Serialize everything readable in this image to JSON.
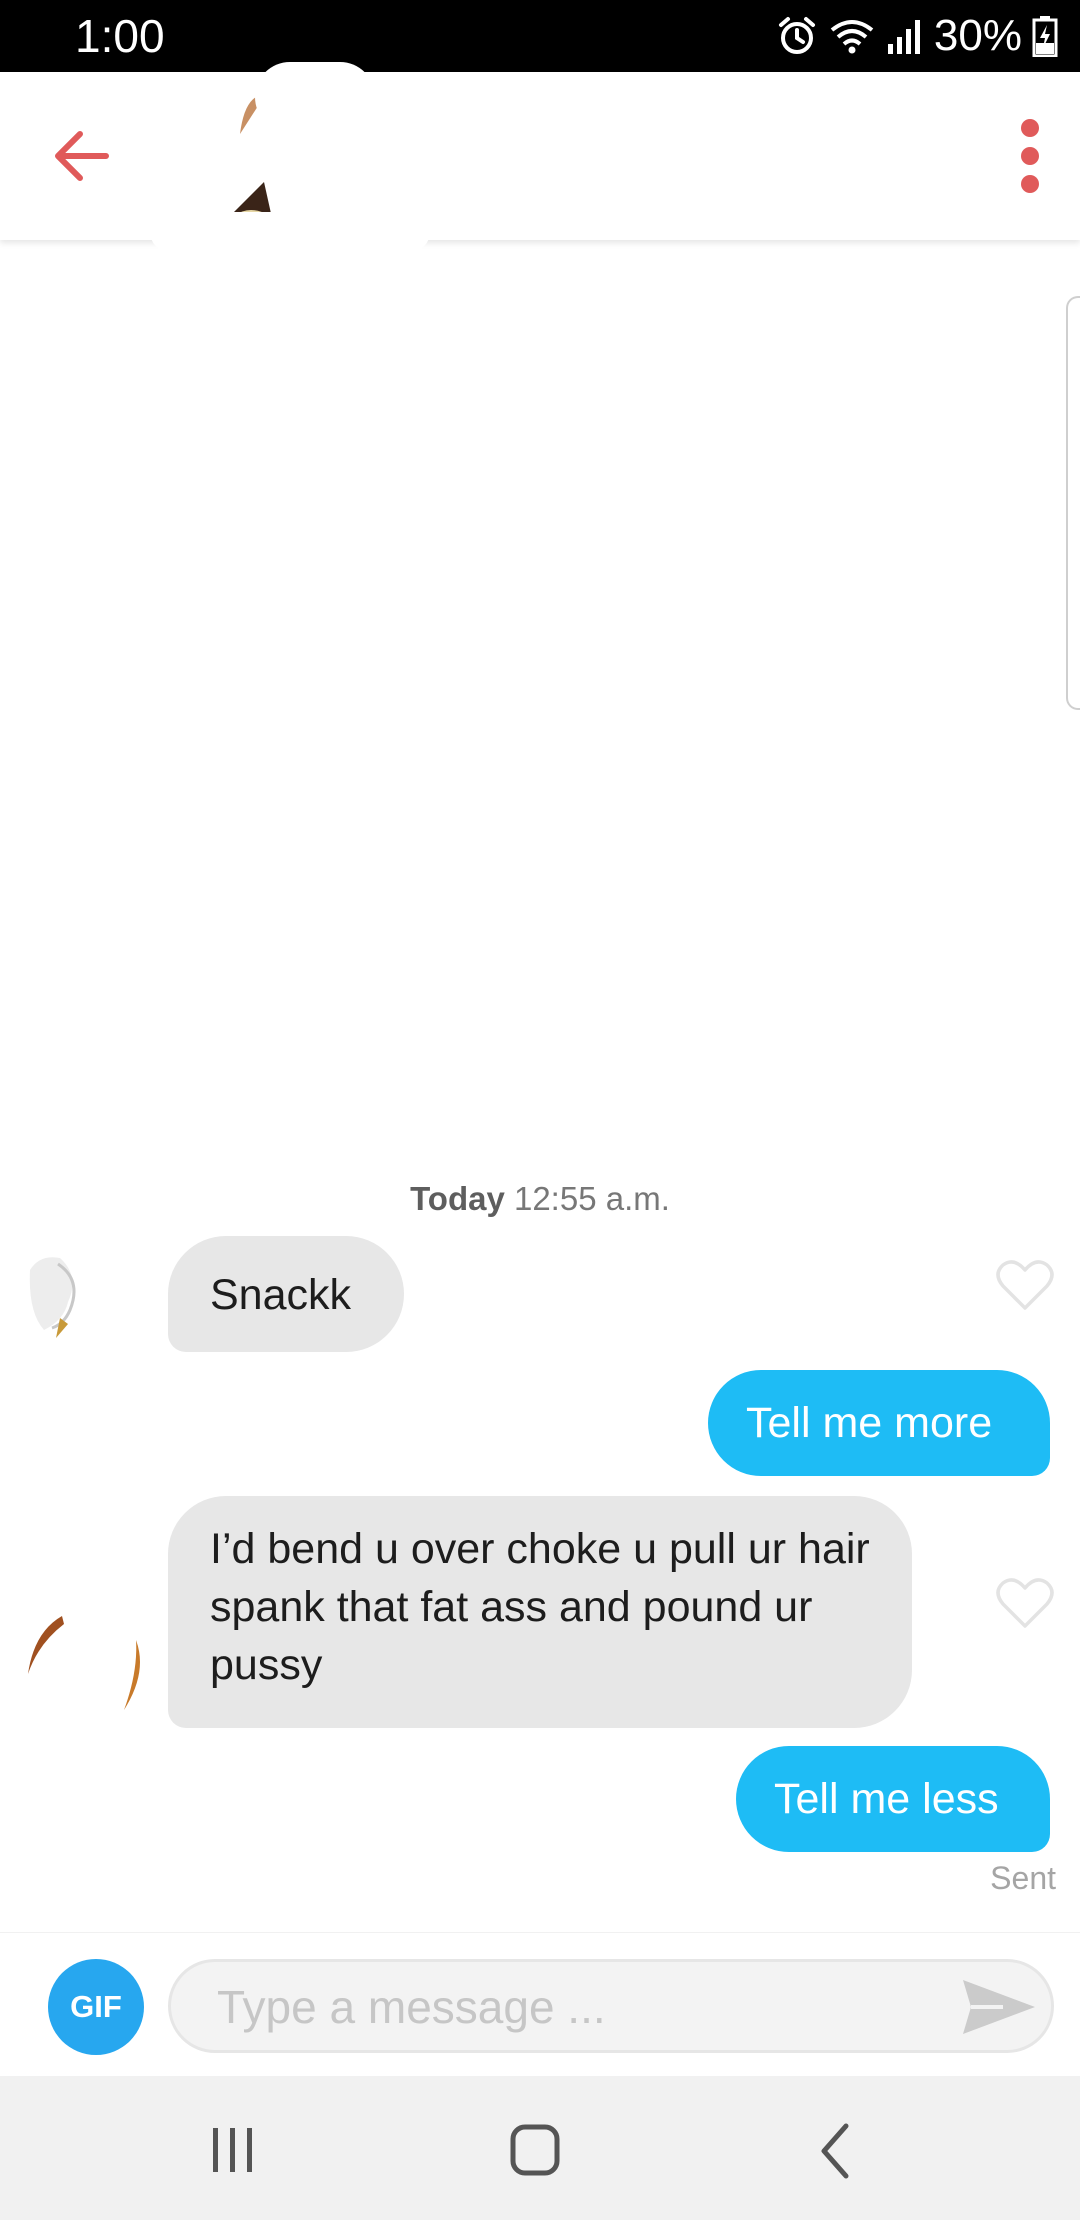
{
  "status_bar": {
    "time": "1:00",
    "battery": "30%",
    "icons": [
      "alarm-icon",
      "wifi-icon",
      "signal-icon",
      "battery-charging-icon"
    ]
  },
  "header": {
    "back_icon": "arrow-left-icon",
    "menu_icon": "more-vertical-icon",
    "accent_color": "#e05a5a"
  },
  "conversation": {
    "date_day": "Today",
    "date_time": " 12:55 a.m.",
    "messages": [
      {
        "direction": "in",
        "text": "Snackk"
      },
      {
        "direction": "out",
        "text": "Tell me more"
      },
      {
        "direction": "in",
        "text": "I’d bend u over choke u pull ur hair spank that fat ass and pound ur pussy"
      },
      {
        "direction": "out",
        "text": "Tell me less"
      }
    ],
    "sent_status": "Sent",
    "incoming_bubble_color": "#e7e7e7",
    "outgoing_bubble_color": "#1ebcf5"
  },
  "composer": {
    "gif_label": "GIF",
    "placeholder": "Type a message ...",
    "value": "",
    "send_icon": "send-icon"
  },
  "nav_bar": {
    "icons": [
      "recent-apps-icon",
      "home-icon",
      "back-icon"
    ]
  }
}
